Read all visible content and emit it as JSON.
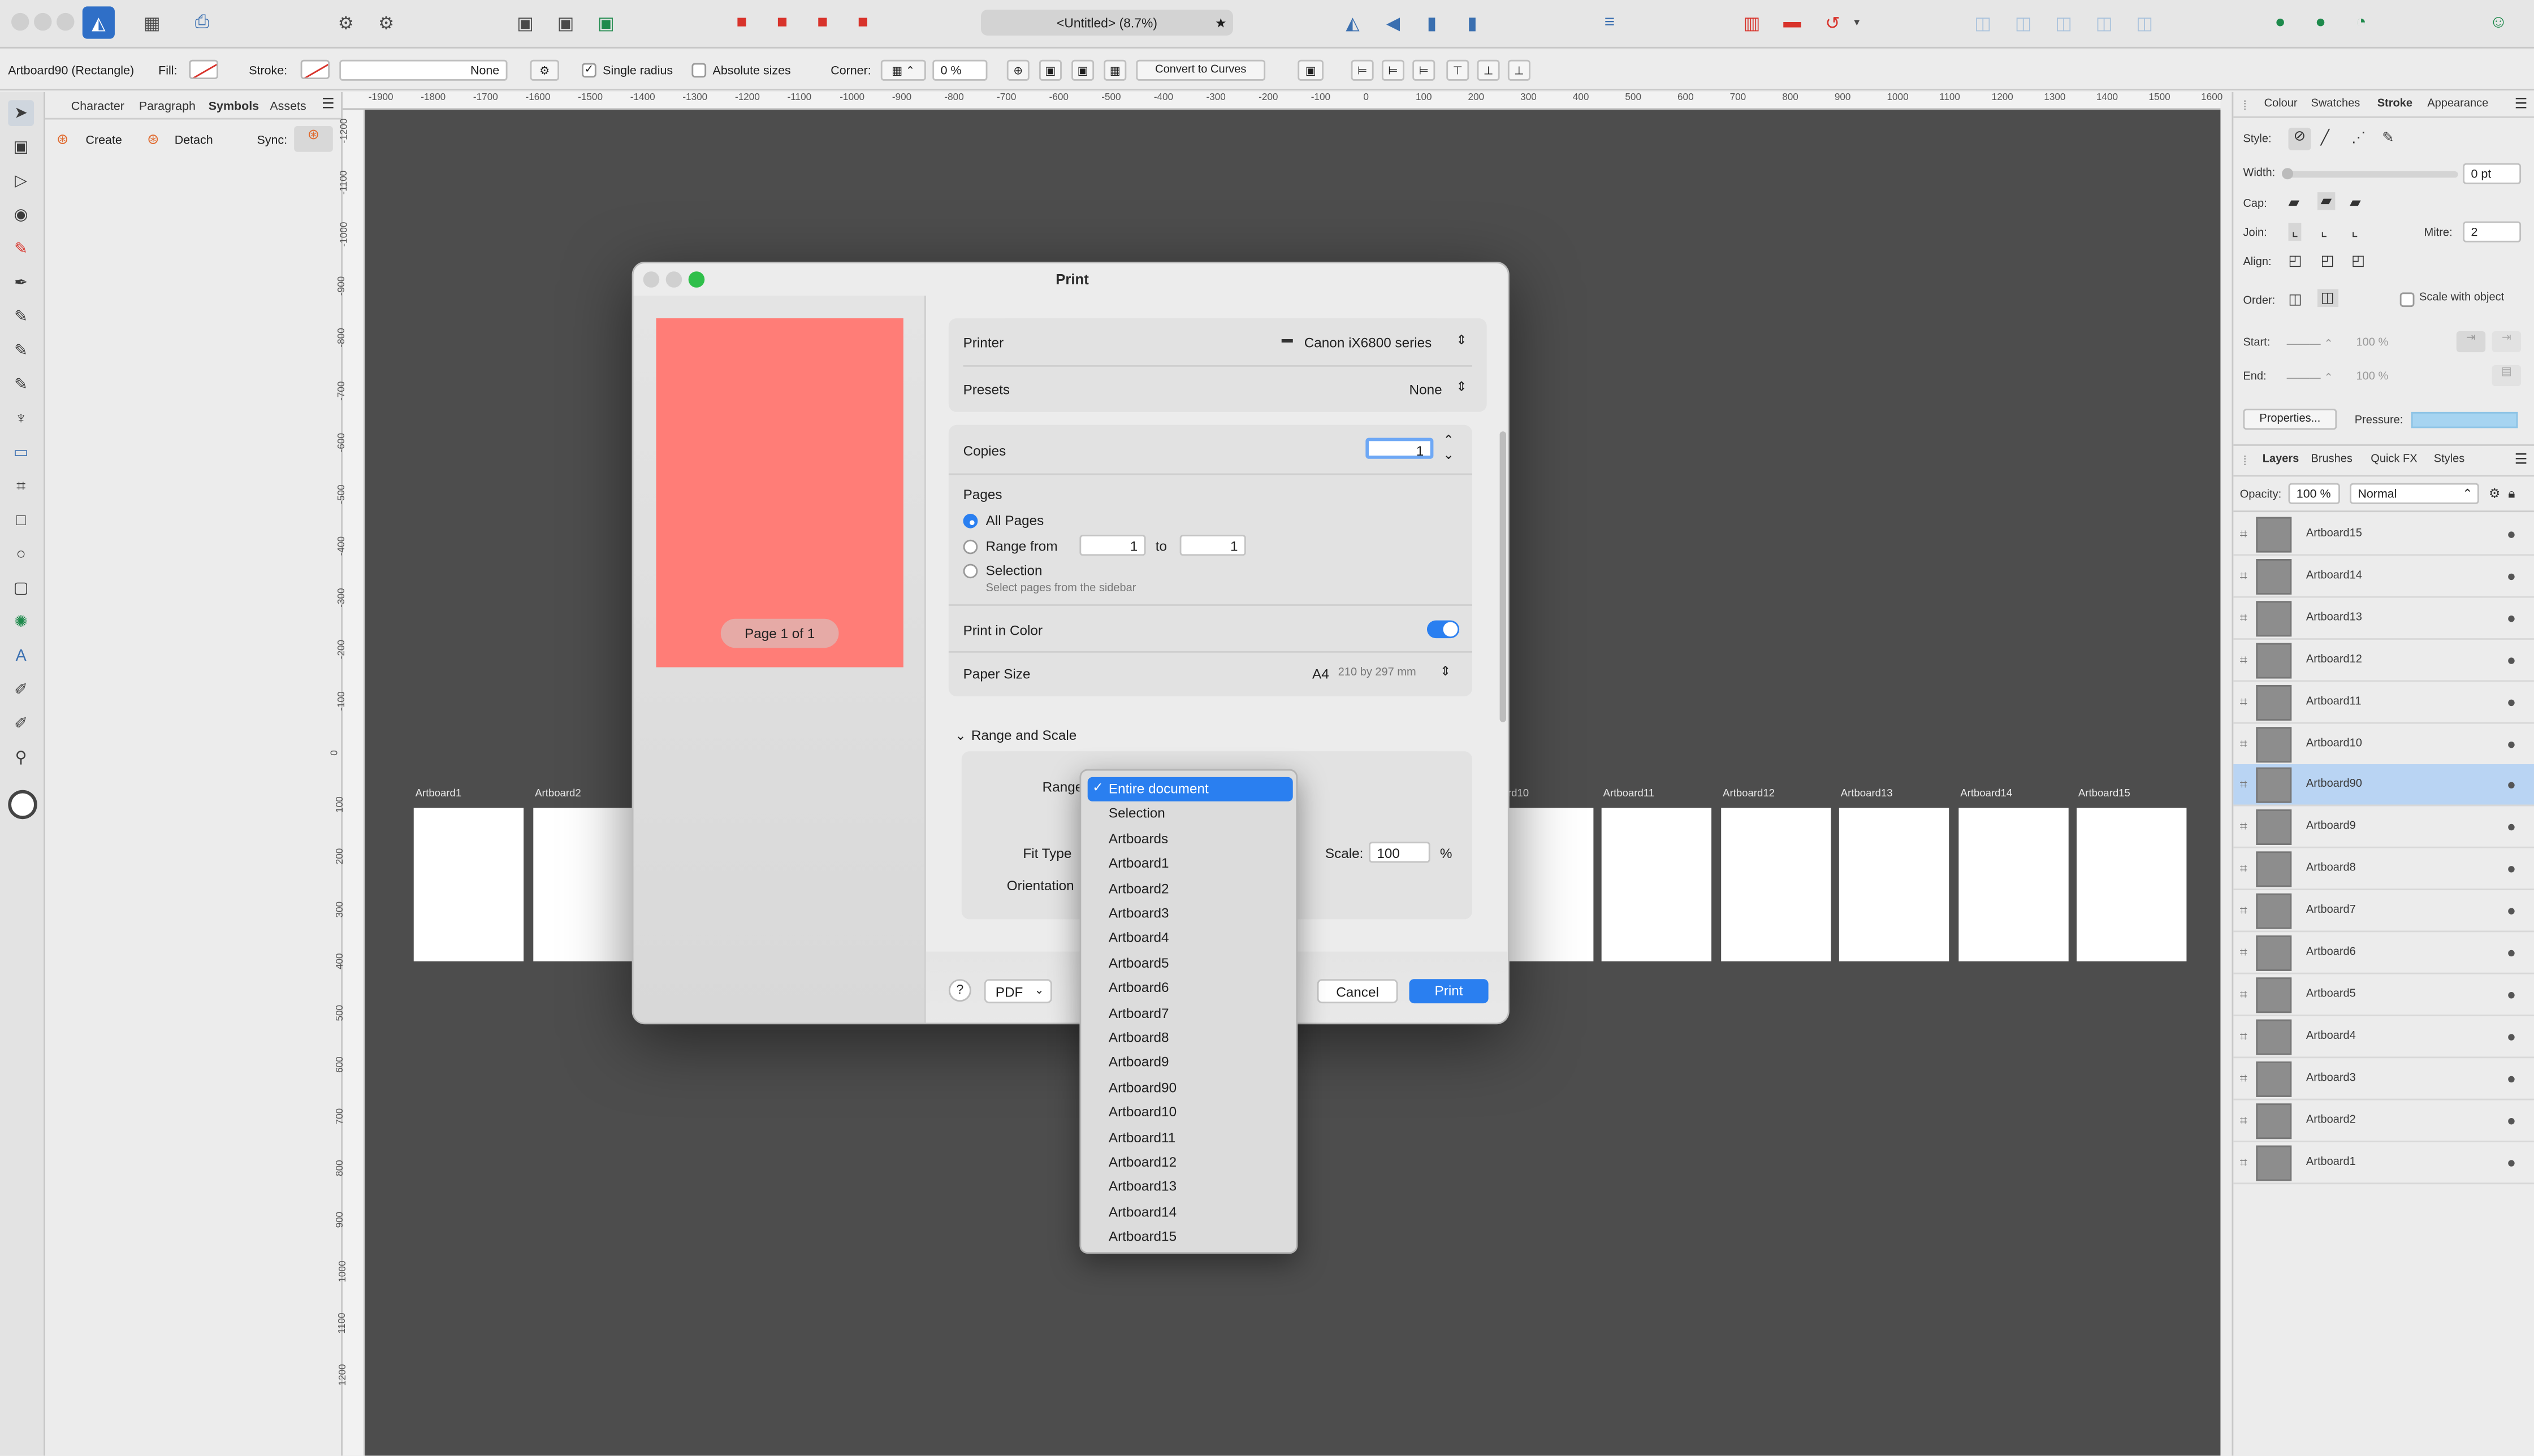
{
  "window": {
    "document_title": "<Untitled> (8.7%)"
  },
  "context": {
    "selection_label": "Artboard90 (Rectangle)",
    "fill_label": "Fill:",
    "stroke_label": "Stroke:",
    "stroke_value": "None",
    "single_radius_label": "Single radius",
    "absolute_sizes_label": "Absolute sizes",
    "corner_label": "Corner:",
    "corner_value": "0 %",
    "convert_label": "Convert to Curves"
  },
  "left_panel": {
    "tabs": [
      "Character",
      "Paragraph",
      "Symbols",
      "Assets"
    ],
    "active_tab": "Symbols",
    "create_label": "Create",
    "detach_label": "Detach",
    "sync_label": "Sync:"
  },
  "rulers": {
    "h_ticks": [
      "-1900",
      "-1800",
      "-1700",
      "-1600",
      "-1500",
      "-1400",
      "-1300",
      "-1200",
      "-1100",
      "-1000",
      "-900",
      "-800",
      "-700",
      "-600",
      "-500",
      "-400",
      "-300",
      "-200",
      "-100",
      "0",
      "100",
      "200",
      "300",
      "400",
      "500",
      "600",
      "700",
      "800",
      "900",
      "1000",
      "1100",
      "1200",
      "1300",
      "1400",
      "1500",
      "1600"
    ],
    "v_ticks": [
      "-1200",
      "-1100",
      "-1000",
      "-900",
      "-800",
      "-700",
      "-600",
      "-500",
      "-400",
      "-300",
      "-200",
      "-100",
      "0",
      "100",
      "200",
      "300",
      "400",
      "500",
      "600",
      "700",
      "800",
      "900",
      "1000",
      "1100",
      "1200"
    ]
  },
  "canvas": {
    "artboards_left": [
      "Artboard1",
      "Artboard2"
    ],
    "artboards_right": [
      "rd10",
      "Artboard11",
      "Artboard12",
      "Artboard13",
      "Artboard14",
      "Artboard15"
    ]
  },
  "right_panel": {
    "top_tabs": [
      "Colour",
      "Swatches",
      "Stroke",
      "Appearance"
    ],
    "active_top_tab": "Stroke",
    "style_label": "Style:",
    "width_label": "Width:",
    "width_value": "0 pt",
    "cap_label": "Cap:",
    "join_label": "Join:",
    "mitre_label": "Mitre:",
    "mitre_value": "2",
    "align_label": "Align:",
    "order_label": "Order:",
    "scale_with_object_label": "Scale with object",
    "start_label": "Start:",
    "start_value": "100 %",
    "end_label": "End:",
    "end_value": "100 %",
    "properties_label": "Properties...",
    "pressure_label": "Pressure:",
    "layer_tabs": [
      "Layers",
      "Brushes",
      "Quick FX",
      "Styles"
    ],
    "active_layer_tab": "Layers",
    "opacity_label": "Opacity:",
    "opacity_value": "100 %",
    "blend_mode": "Normal",
    "layers": [
      "Artboard15",
      "Artboard14",
      "Artboard13",
      "Artboard12",
      "Artboard11",
      "Artboard10",
      "Artboard90",
      "Artboard9",
      "Artboard8",
      "Artboard7",
      "Artboard6",
      "Artboard5",
      "Artboard4",
      "Artboard3",
      "Artboard2",
      "Artboard1"
    ],
    "selected_layer": "Artboard90"
  },
  "print_dialog": {
    "title": "Print",
    "page_indicator": "Page 1 of 1",
    "printer_label": "Printer",
    "printer_value": "Canon iX6800 series",
    "presets_label": "Presets",
    "presets_value": "None",
    "copies_label": "Copies",
    "copies_value": "1",
    "pages_label": "Pages",
    "all_pages_label": "All Pages",
    "range_from_label": "Range from",
    "range_from_value": "1",
    "range_to_label": "to",
    "range_to_value": "1",
    "selection_label": "Selection",
    "selection_hint": "Select pages from the sidebar",
    "print_in_color_label": "Print in Color",
    "print_in_color_on": true,
    "paper_size_label": "Paper Size",
    "paper_size_value": "A4",
    "paper_size_detail": "210 by 297 mm",
    "range_and_scale_label": "Range and Scale",
    "range_label": "Range",
    "fit_type_label": "Fit Type",
    "orientation_label": "Orientation",
    "scale_label": "Scale:",
    "scale_value": "100",
    "scale_unit": "%",
    "help_label": "?",
    "pdf_label": "PDF",
    "cancel_label": "Cancel",
    "print_label": "Print"
  },
  "range_dropdown": {
    "options": [
      "Entire document",
      "Selection",
      "Artboards",
      "Artboard1",
      "Artboard2",
      "Artboard3",
      "Artboard4",
      "Artboard5",
      "Artboard6",
      "Artboard7",
      "Artboard8",
      "Artboard9",
      "Artboard90",
      "Artboard10",
      "Artboard11",
      "Artboard12",
      "Artboard13",
      "Artboard14",
      "Artboard15"
    ],
    "selected": "Entire document"
  },
  "colors": {
    "accent": "#2a7ff0",
    "preview_page": "#ff7d77",
    "canvas": "#4d4d4d"
  }
}
